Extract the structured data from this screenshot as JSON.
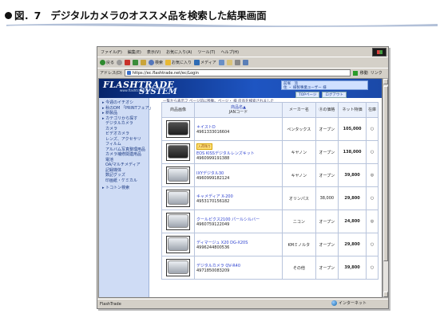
{
  "caption": "図．7　デジタルカメラのオススメ品を検索した結果画面",
  "browser": {
    "menu": [
      "ファイル(F)",
      "編集(E)",
      "表示(V)",
      "お気に入り(A)",
      "ツール(T)",
      "ヘルプ(H)"
    ],
    "toolbar": {
      "back": "戻る",
      "search": "検索",
      "favorites": "お気に入り",
      "media": "メディア"
    },
    "address_label": "アドレス(D)",
    "url": "https://ec.flashtrade.net/ec/Login",
    "go": "移動",
    "links": "リンク",
    "status_text": "FlashTrade",
    "zone": "インターネット"
  },
  "site": {
    "logo": "FLASHTRADE",
    "logo_url": "www.flashtrade.net",
    "logo_system": "SYSTEM",
    "user_info": [
      "前塚　流",
      "住 ・ 様製事業ユーザー 様"
    ],
    "links": [
      "TOPページ",
      "ログアウト"
    ],
    "breadcrumb": "一覧から表示フ ページ前に移動。ページ・ 様 戻品を検索されました",
    "sidebar": [
      {
        "label": "今週のイチオシ",
        "sub": []
      },
      {
        "label": "秋のDM 「PRINTフェア」",
        "sub": []
      },
      {
        "label": "新製品",
        "sub": []
      },
      {
        "label": "カテゴリから探す",
        "sub": [
          "デジタルカメラ",
          "カメラ",
          "ビデオカメラ",
          "レンズ、アクセサリ",
          "フィルム",
          "アルバム写真整理用品",
          "カメラ補修関連用品",
          "電池",
          "OA/マルチメディア",
          "記録媒体",
          "数記グッズ",
          "印画紙・ケミカル"
        ]
      },
      {
        "label": "トコトン検索",
        "sub": []
      }
    ]
  },
  "table": {
    "headers": {
      "image": "商品画像",
      "name": "商品名▲",
      "jan": "JANコード",
      "maker": "メーカー名",
      "list_price": "Ⓡの価格",
      "net_price": "ネット特価",
      "stock": "在庫"
    },
    "rows": [
      {
        "name": "＊イストD",
        "jan": "4961333016604",
        "maker": "ペンタックス",
        "list": "オープン",
        "net": "105,000",
        "stock": "○",
        "badge": "",
        "img": "dark"
      },
      {
        "name": "EOS KISSデジタルレンズキット",
        "jan": "4960999191388",
        "maker": "キヤノン",
        "list": "オープン",
        "net": "138,000",
        "stock": "○",
        "badge": "入荷残り",
        "img": "dark"
      },
      {
        "name": "IXYデジタル30",
        "jan": "4960999182124",
        "maker": "キヤノン",
        "list": "オープン",
        "net": "39,800",
        "stock": "◎",
        "badge": "",
        "img": "silver"
      },
      {
        "name": "キャメディア X-200",
        "jan": "4953170156182",
        "maker": "オリンパス",
        "list": "38,000",
        "net": "29,800",
        "stock": "○",
        "badge": "",
        "img": "silver"
      },
      {
        "name": "クールピクス2100 パールシルバー",
        "jan": "4960759122049",
        "maker": "ニコン",
        "list": "オープン",
        "net": "24,800",
        "stock": "◎",
        "badge": "",
        "img": "silver"
      },
      {
        "name": "ディマージュ X20 DG-X20S",
        "jan": "4996244800536",
        "maker": "KMミノルタ",
        "list": "オープン",
        "net": "29,800",
        "stock": "○",
        "badge": "",
        "img": "silver"
      },
      {
        "name": "デジタルカメラ QV-R40",
        "jan": "4971850083209",
        "maker": "その他",
        "list": "オープン",
        "net": "39,800",
        "stock": "○",
        "badge": "",
        "img": "silver"
      }
    ]
  }
}
